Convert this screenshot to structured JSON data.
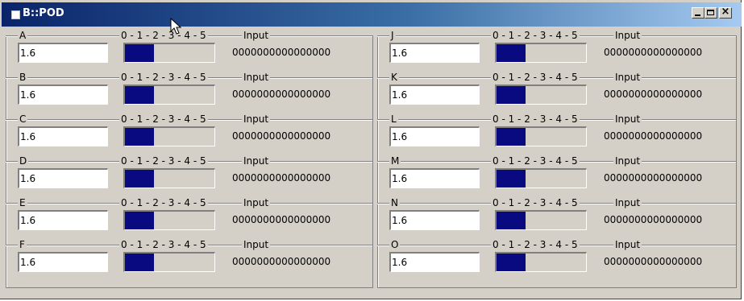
{
  "window": {
    "title": "B::POD",
    "buttons": {
      "minimize": "minimize",
      "maximize": "maximize",
      "close": "×"
    }
  },
  "legend": {
    "scale": "0 - 1 - 2 - 3 - 4 - 5",
    "input": "Input"
  },
  "colors": {
    "bar_fill": "#0a0a80",
    "titlebar_start": "#0a246a",
    "titlebar_end": "#a6caf0",
    "face": "#d4d0c8"
  },
  "channels": [
    {
      "name": "A",
      "value": "1.6",
      "level": 1.6,
      "bits": "0000000000000000"
    },
    {
      "name": "B",
      "value": "1.6",
      "level": 1.6,
      "bits": "0000000000000000"
    },
    {
      "name": "C",
      "value": "1.6",
      "level": 1.6,
      "bits": "0000000000000000"
    },
    {
      "name": "D",
      "value": "1.6",
      "level": 1.6,
      "bits": "0000000000000000"
    },
    {
      "name": "E",
      "value": "1.6",
      "level": 1.6,
      "bits": "0000000000000000"
    },
    {
      "name": "F",
      "value": "1.6",
      "level": 1.6,
      "bits": "0000000000000000"
    },
    {
      "name": "J",
      "value": "1.6",
      "level": 1.6,
      "bits": "0000000000000000"
    },
    {
      "name": "K",
      "value": "1.6",
      "level": 1.6,
      "bits": "0000000000000000"
    },
    {
      "name": "L",
      "value": "1.6",
      "level": 1.6,
      "bits": "0000000000000000"
    },
    {
      "name": "M",
      "value": "1.6",
      "level": 1.6,
      "bits": "0000000000000000"
    },
    {
      "name": "N",
      "value": "1.6",
      "level": 1.6,
      "bits": "0000000000000000"
    },
    {
      "name": "O",
      "value": "1.6",
      "level": 1.6,
      "bits": "0000000000000000"
    }
  ]
}
